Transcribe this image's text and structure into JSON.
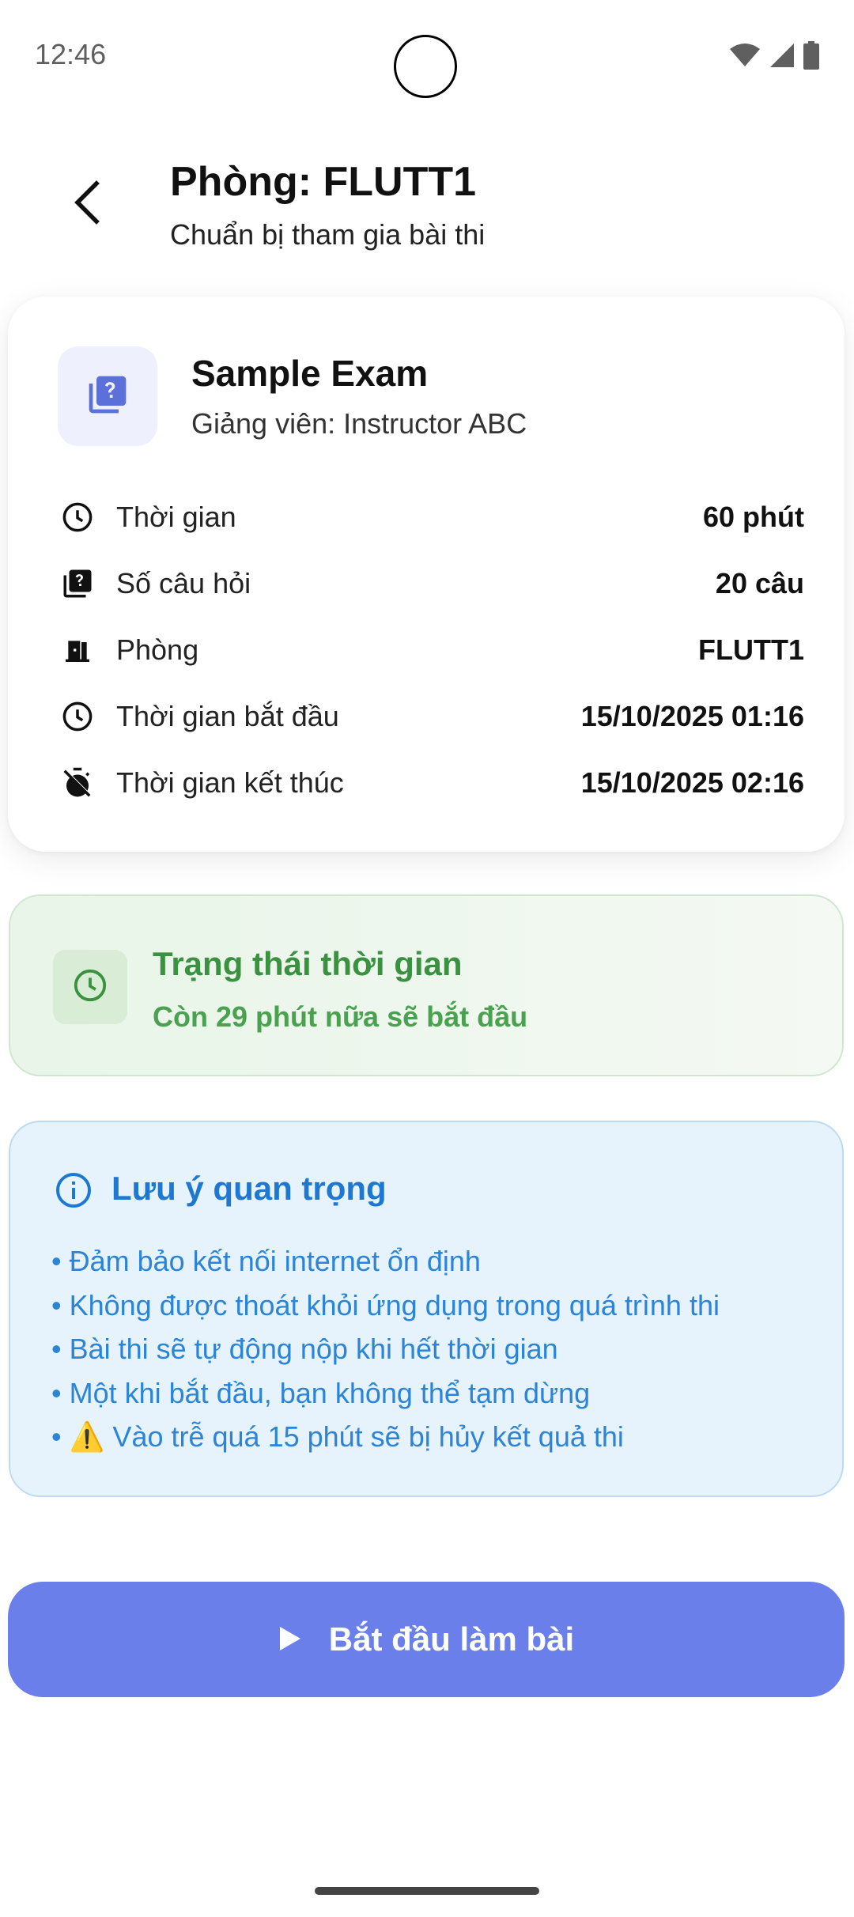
{
  "status_bar": {
    "time": "12:46",
    "icons": [
      "wifi-icon",
      "signal-icon",
      "battery-icon"
    ]
  },
  "header": {
    "title": "Phòng: FLUTT1",
    "subtitle": "Chuẩn bị tham gia bài thi"
  },
  "exam": {
    "name": "Sample Exam",
    "instructor": "Giảng viên: Instructor ABC",
    "rows": [
      {
        "icon": "clock-icon",
        "label": "Thời gian",
        "value": "60 phút"
      },
      {
        "icon": "question-book-icon",
        "label": "Số câu hỏi",
        "value": "20 câu"
      },
      {
        "icon": "door-icon",
        "label": "Phòng",
        "value": "FLUTT1"
      },
      {
        "icon": "clock-icon",
        "label": "Thời gian bắt đầu",
        "value": "15/10/2025 01:16"
      },
      {
        "icon": "timer-off-icon",
        "label": "Thời gian kết thúc",
        "value": "15/10/2025 02:16"
      }
    ]
  },
  "time_status": {
    "title": "Trạng thái thời gian",
    "text": "Còn 29 phút nữa sẽ bắt đầu"
  },
  "notes": {
    "title": "Lưu ý quan trọng",
    "items": [
      "• Đảm bảo kết nối internet ổn định",
      "• Không được thoát khỏi ứng dụng trong quá trình thi",
      "• Bài thi sẽ tự động nộp khi hết thời gian",
      "• Một khi bắt đầu, bạn không thể tạm dừng",
      "• ⚠️ Vào trễ quá 15 phút sẽ bị hủy kết quả thi"
    ]
  },
  "start_button": {
    "label": "Bắt đầu làm bài"
  },
  "colors": {
    "accent": "#6a7fe9",
    "success": "#3a9140",
    "info": "#1e77d0"
  }
}
